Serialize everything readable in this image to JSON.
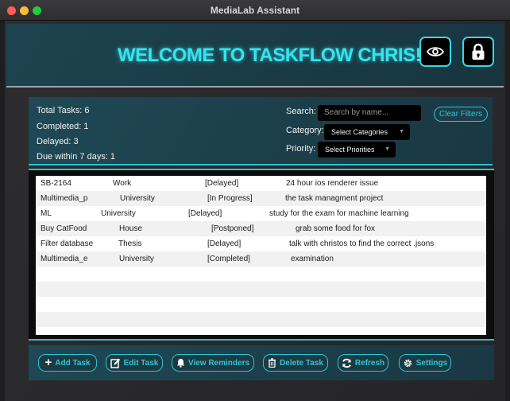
{
  "window": {
    "title": "MediaLab Assistant"
  },
  "header": {
    "welcome": "WELCOME TO TASKFLOW CHRIS!"
  },
  "stats": {
    "total": "Total Tasks: 6",
    "completed": "Completed: 1",
    "delayed": "Delayed: 3",
    "due": "Due within 7 days: 1"
  },
  "filters": {
    "search_label": "Search:",
    "search_placeholder": "Search by name...",
    "category_label": "Category:",
    "category_value": "Select Categories",
    "priority_label": "Priority:",
    "priority_value": "Select Priorities",
    "clear_label": "Clear Filters"
  },
  "tasks": [
    {
      "name": "SB-2164",
      "category": "Work",
      "status": "[Delayed]",
      "description": "24 hour ios renderer issue"
    },
    {
      "name": "Multimedia_p",
      "category": "University",
      "status": "[In Progress]",
      "description": "the task managment project"
    },
    {
      "name": "ML",
      "category": "University",
      "status": "[Delayed]",
      "description": "study for the exam for machine learning"
    },
    {
      "name": "Buy CatFood",
      "category": "House",
      "status": "[Postponed]",
      "description": "grab some food for fox"
    },
    {
      "name": "Filter database",
      "category": "Thesis",
      "status": "[Delayed]",
      "description": "talk with christos to find the correct .jsons"
    },
    {
      "name": "Multimedia_e",
      "category": "University",
      "status": "[Completed]",
      "description": "examination"
    }
  ],
  "footer": {
    "add": "Add Task",
    "edit": "Edit Task",
    "reminders": "View Reminders",
    "delete": "Delete Task",
    "refresh": "Refresh",
    "settings": "Settings"
  },
  "colors": {
    "accent": "#2fc5cf",
    "title_glow": "#34e4ee",
    "panel": "#1b3e49"
  },
  "icons": [
    "eye-icon",
    "lock-icon",
    "plus-icon",
    "edit-icon",
    "bell-icon",
    "trash-icon",
    "refresh-icon",
    "gear-icon"
  ]
}
